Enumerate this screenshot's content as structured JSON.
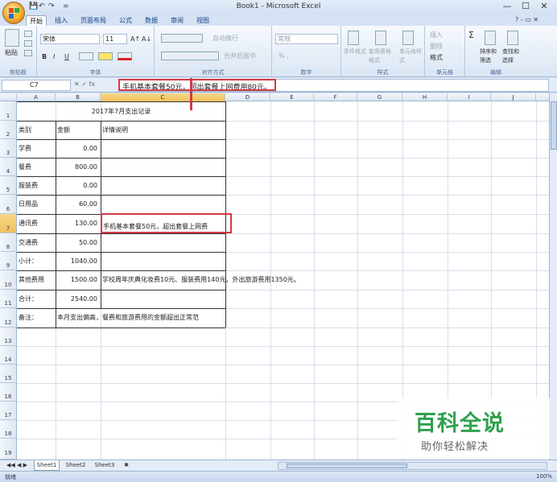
{
  "window": {
    "title": "Book1 - Microsoft Excel",
    "qat_save": "💾",
    "qat_undo": "↶",
    "qat_redo": "↷",
    "qat_more": "=",
    "min": "—",
    "max": "☐",
    "close": "✕"
  },
  "ribbon": {
    "tabs": [
      "开始",
      "插入",
      "页面布局",
      "公式",
      "数据",
      "审阅",
      "视图"
    ],
    "help": "? - ▭ ✕",
    "clipboard": {
      "paste": "粘贴",
      "label": "剪贴板"
    },
    "font": {
      "name": "宋体",
      "size": "11",
      "grow": "A↑",
      "shrink": "A↓",
      "bold": "B",
      "italic": "I",
      "underline": "U",
      "label": "字体"
    },
    "align": {
      "wrap": "自动换行",
      "merge": "合并后居中",
      "label": "对齐方式"
    },
    "number": {
      "format": "常规",
      "pct": "% ,",
      "label": "数字"
    },
    "styles": {
      "cond": "条件格式",
      "table": "套用表格格式",
      "cell": "单元格样式",
      "label": "样式"
    },
    "cells": {
      "insert": "插入",
      "delete": "删除",
      "format": "格式",
      "label": "单元格"
    },
    "edit": {
      "sum": "Σ",
      "sort": "排序和筛选",
      "find": "查找和选择",
      "label": "编辑"
    }
  },
  "formula_bar": {
    "name_box": "C7",
    "fx": "fx",
    "content": "手机基本套餐50元，超出套餐上网费用80元。"
  },
  "columns": [
    "A",
    "B",
    "C",
    "D",
    "E",
    "F",
    "G",
    "H",
    "I",
    "J"
  ],
  "rows": [
    "1",
    "2",
    "3",
    "4",
    "5",
    "6",
    "7",
    "8",
    "9",
    "10",
    "11",
    "12",
    "13",
    "14",
    "15",
    "16",
    "17",
    "18",
    "19"
  ],
  "sheet": {
    "title": "2017年7月支出记录",
    "headers": {
      "a": "类别",
      "b": "金额",
      "c": "详情说明"
    },
    "records": [
      {
        "cat": "学费",
        "amt": "0.00",
        "note": ""
      },
      {
        "cat": "餐费",
        "amt": "800.00",
        "note": ""
      },
      {
        "cat": "服装费",
        "amt": "0.00",
        "note": ""
      },
      {
        "cat": "日用品",
        "amt": "60.00",
        "note": ""
      },
      {
        "cat": "通讯费",
        "amt": "130.00",
        "note": "手机基本套餐50元，超出套餐上网费"
      },
      {
        "cat": "交通费",
        "amt": "50.00",
        "note": ""
      },
      {
        "cat": "小计：",
        "amt": "1040.00",
        "note": ""
      },
      {
        "cat": "其他费用",
        "amt": "1500.00",
        "note": "学校周年庆典化妆费10元、服装费用140元，外出旅游费用1350元。"
      },
      {
        "cat": "合计：",
        "amt": "2540.00",
        "note": ""
      }
    ],
    "remark_label": "备注：",
    "remark_text": "本月支出偏高，餐费和旅游费用的金额超出正常范"
  },
  "sheet_tabs": [
    "Sheet1",
    "Sheet2",
    "Sheet3"
  ],
  "nav_arrows": "◀◀ ◀ ▶ ▶▶",
  "status": {
    "mode": "就绪",
    "zoom": "100%"
  },
  "watermark": {
    "title": "百科全说",
    "subtitle": "助你轻松解决"
  },
  "colors": {
    "accent_red": "#d23a46",
    "watermark_green": "#2fa04e"
  }
}
